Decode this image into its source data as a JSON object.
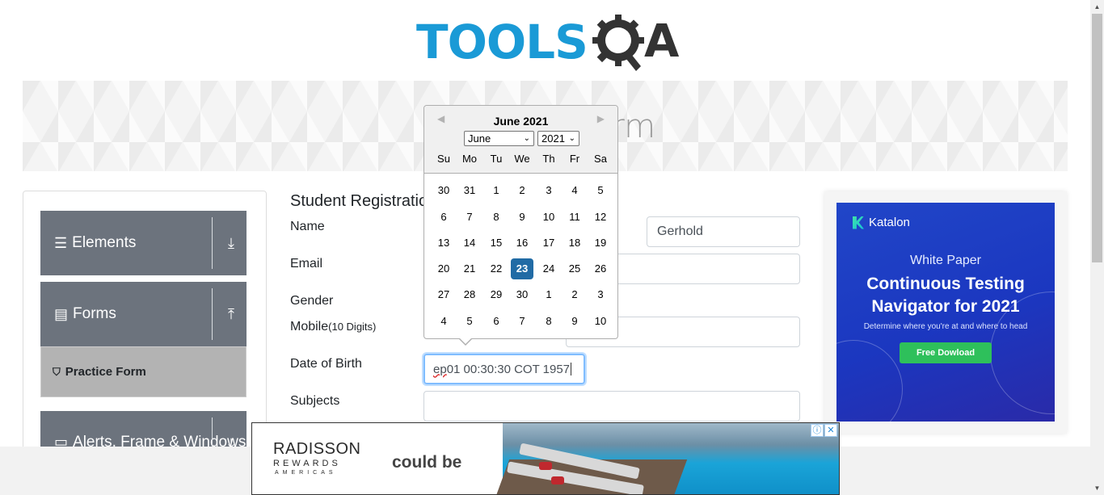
{
  "logo": {
    "text": "TOOLS",
    "text2": "A"
  },
  "banner": {
    "title": "Practice Form"
  },
  "sidebar": {
    "groups": [
      {
        "label": "Elements",
        "icon": "hamburger-icon",
        "arrow": "download-arrow-icon"
      },
      {
        "label": "Forms",
        "icon": "document-icon",
        "arrow": "upload-arrow-icon"
      },
      {
        "label": "Alerts, Frame & Windows",
        "icon": "window-icon",
        "arrow": "download-arrow-icon"
      }
    ],
    "subitem": {
      "label": "Practice Form",
      "icon": "html5-icon"
    }
  },
  "form": {
    "title": "Student Registration Form",
    "name_label": "Name",
    "last_name_value": "Gerhold",
    "email_label": "Email",
    "gender_label": "Gender",
    "mobile_label": "Mobile",
    "mobile_hint": "(10 Digits)",
    "dob_label": "Date of Birth",
    "dob_value_prefix": "ep",
    "dob_value_rest": " 01 00:30:30 COT 1957",
    "subjects_label": "Subjects"
  },
  "datepicker": {
    "header": "June 2021",
    "month_select": "June",
    "year_select": "2021",
    "day_names": [
      "Su",
      "Mo",
      "Tu",
      "We",
      "Th",
      "Fr",
      "Sa"
    ],
    "weeks": [
      [
        "30",
        "31",
        "1",
        "2",
        "3",
        "4",
        "5"
      ],
      [
        "6",
        "7",
        "8",
        "9",
        "10",
        "11",
        "12"
      ],
      [
        "13",
        "14",
        "15",
        "16",
        "17",
        "18",
        "19"
      ],
      [
        "20",
        "21",
        "22",
        "23",
        "24",
        "25",
        "26"
      ],
      [
        "27",
        "28",
        "29",
        "30",
        "1",
        "2",
        "3"
      ],
      [
        "4",
        "5",
        "6",
        "7",
        "8",
        "9",
        "10"
      ]
    ],
    "selected": "23"
  },
  "ad_right": {
    "brand": "Katalon",
    "sub": "White Paper",
    "headline": "Continuous Testing Navigator for 2021",
    "desc": "Determine where you're at and where to head",
    "button": "Free Dowload"
  },
  "ad_bottom": {
    "brand1": "RADISSON",
    "brand2": "REWARDS",
    "brand3": "AMERICAS",
    "tagline": "could be",
    "info": "ⓘ",
    "close": "✕"
  },
  "colors": {
    "logo_blue": "#1a9ad6",
    "sidebar_gray": "#6c737d",
    "selected_day": "#216ba5"
  }
}
